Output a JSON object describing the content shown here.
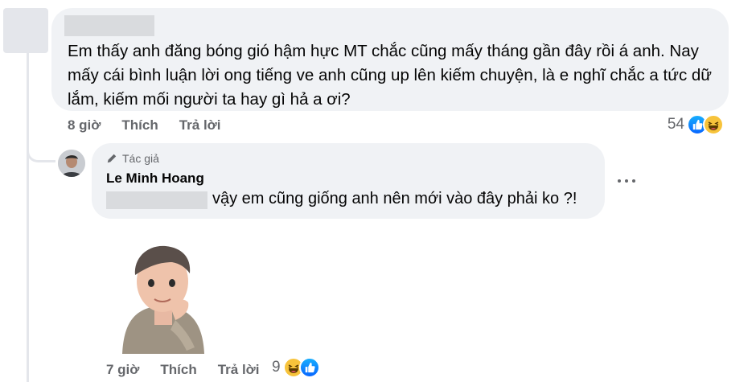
{
  "colors": {
    "bubble": "#f0f2f5",
    "meta": "#65676b",
    "like": "#0866ff",
    "haha": "#f7c33b"
  },
  "comment": {
    "text": "Em thấy anh đăng bóng gió hậm hực MT chắc cũng mấy tháng gần đây rồi á anh. Nay mấy cái bình luận lời ong tiếng ve anh cũng up lên kiếm chuyện, là e nghĩ chắc a tức dữ lắm, kiếm mối người ta hay gì hả a ơi?",
    "time": "8 giờ",
    "like_label": "Thích",
    "reply_label": "Trả lời",
    "reaction_count": "54",
    "reaction_icons": [
      "like-icon",
      "haha-icon"
    ]
  },
  "reply": {
    "author_badge": "Tác giả",
    "author_name": "Le Minh Hoang",
    "text": "vậy em cũng giống anh nên mới vào đây phải ko ?!",
    "time": "7 giờ",
    "like_label": "Thích",
    "reply_label": "Trả lời",
    "reaction_count": "9",
    "reaction_icons": [
      "haha-icon",
      "like-icon"
    ]
  }
}
